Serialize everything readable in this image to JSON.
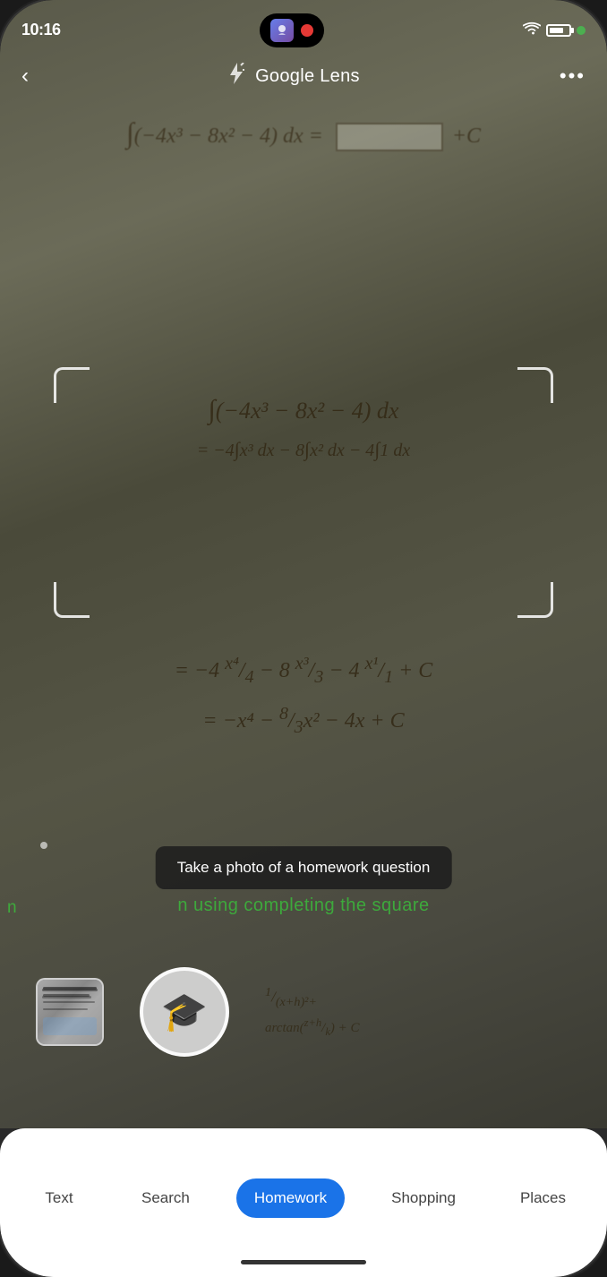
{
  "statusBar": {
    "time": "10:16",
    "recordingIndicator": "●"
  },
  "header": {
    "title": "Google Lens",
    "backLabel": "‹",
    "flashLabel": "⚡",
    "moreLabel": "•••"
  },
  "math": {
    "topEquation": "∫(−4x³ − 8x² − 4) dx =",
    "line1": "∫(−4x³ − 8x²− 4) dx",
    "line2": "= −4∫x³ dx − 8∫x² dx − 4∫1 dx",
    "line3": "= −4 x⁴/4 − 8 x³/3 − 4 x¹/1 + C",
    "line4": "= −x⁴ − 8/3 x² − 4x + C"
  },
  "hint": {
    "text": "Take a photo of a homework question"
  },
  "partialText": {
    "visible": "n using completing the square"
  },
  "mathExtra": {
    "fraction": "1/(x+h)² +",
    "rightSide": "arctan((z+h)/k) + C"
  },
  "tabs": {
    "items": [
      {
        "id": "text",
        "label": "Text",
        "active": false
      },
      {
        "id": "search",
        "label": "Search",
        "active": false
      },
      {
        "id": "homework",
        "label": "Homework",
        "active": true
      },
      {
        "id": "shopping",
        "label": "Shopping",
        "active": false
      },
      {
        "id": "places",
        "label": "Places",
        "active": false
      }
    ]
  },
  "colors": {
    "activeTab": "#1a73e8",
    "inactiveTab": "#444444",
    "accentGreen": "rgba(60,180,60,0.9)"
  }
}
